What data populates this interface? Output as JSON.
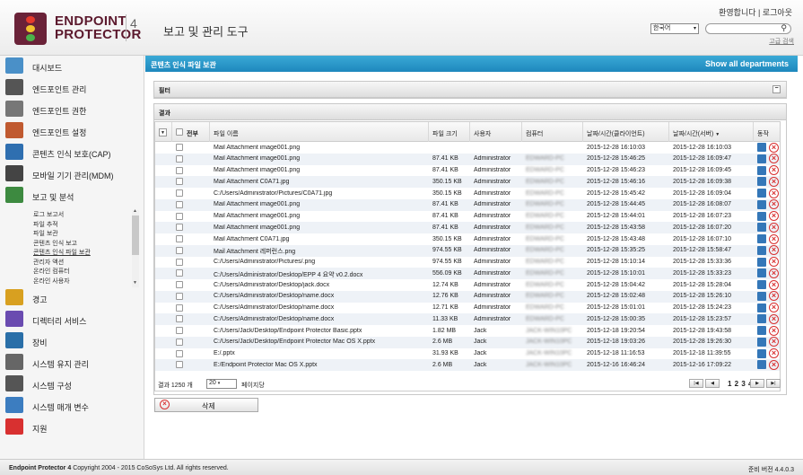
{
  "header": {
    "logo_line1": "ENDPOINT",
    "logo_line2": "PROTECTOR",
    "logo_version": "4",
    "app_title": "보고 및 관리 도구",
    "welcome": "환영합니다 | 로그아웃",
    "language": "한국어",
    "search_placeholder": "",
    "advanced_search": "고급 검색"
  },
  "sidebar": {
    "items": [
      {
        "label": "대시보드",
        "icon": "dashboard-icon",
        "color": "#4a90c8"
      },
      {
        "label": "엔드포인트 관리",
        "icon": "endpoint-management-icon",
        "color": "#555"
      },
      {
        "label": "엔드포인트 권한",
        "icon": "endpoint-rights-icon",
        "color": "#777"
      },
      {
        "label": "엔드포인트 설정",
        "icon": "endpoint-settings-icon",
        "color": "#c05a30"
      },
      {
        "label": "콘텐츠 인식 보호(CAP)",
        "icon": "content-aware-icon",
        "color": "#2f6fb0"
      },
      {
        "label": "모바일 기기 관리(MDM)",
        "icon": "mobile-device-icon",
        "color": "#444"
      },
      {
        "label": "보고 및 분석",
        "icon": "reports-icon",
        "color": "#3d8a40"
      },
      {
        "label": "경고",
        "icon": "alerts-icon",
        "color": "#d8a020"
      },
      {
        "label": "디렉터리 서비스",
        "icon": "directory-services-icon",
        "color": "#6a4bb0"
      },
      {
        "label": "장비",
        "icon": "appliance-icon",
        "color": "#2a6fa8"
      },
      {
        "label": "시스템 유지 관리",
        "icon": "system-maintenance-icon",
        "color": "#666"
      },
      {
        "label": "시스템 구성",
        "icon": "system-configuration-icon",
        "color": "#555"
      },
      {
        "label": "시스템 매개 변수",
        "icon": "system-parameters-icon",
        "color": "#3c7dc0"
      },
      {
        "label": "지원",
        "icon": "support-icon",
        "color": "#d83030"
      }
    ],
    "subitems": [
      "로그 보고서",
      "파일 추적",
      "파일 보관",
      "콘텐츠 인식 보고",
      "콘텐츠 인식 파일 보관",
      "관리자 액션",
      "온라인 컴퓨터",
      "온라인 사용자"
    ],
    "active_subitem": 4
  },
  "main": {
    "banner_title": "콘텐츠 인식 파일 보관",
    "banner_link": "Show all departments",
    "filter_label": "필터",
    "results_label": "결과",
    "collapse_symbol": "−",
    "columns": [
      "전부",
      "파일 이름",
      "파일 크기",
      "사용자",
      "컴퓨터",
      "날짜/시간(클라이언트)",
      "날짜/시간(서버)",
      "동작"
    ],
    "sort_indicator": "▼",
    "rows": [
      {
        "name": "Mail Attachment image001.png",
        "size": "",
        "user": "",
        "computer": "",
        "client": "2015-12-28 16:10:03",
        "server": "2015-12-28 16:10:03"
      },
      {
        "name": "Mail Attachment image001.png",
        "size": "87.41 KB",
        "user": "Administrator",
        "computer": "EDWARD-PC",
        "client": "2015-12-28 15:46:25",
        "server": "2015-12-28 16:09:47"
      },
      {
        "name": "Mail Attachment image001.png",
        "size": "87.41 KB",
        "user": "Administrator",
        "computer": "EDWARD-PC",
        "client": "2015-12-28 15:46:23",
        "server": "2015-12-28 16:09:45"
      },
      {
        "name": "Mail Attachment C0A71.jpg",
        "size": "350.15 KB",
        "user": "Administrator",
        "computer": "EDWARD-PC",
        "client": "2015-12-28 15:46:16",
        "server": "2015-12-28 16:09:38"
      },
      {
        "name": "C:/Users/Administrator/Pictures/C0A71.jpg",
        "size": "350.15 KB",
        "user": "Administrator",
        "computer": "EDWARD-PC",
        "client": "2015-12-28 15:45:42",
        "server": "2015-12-28 16:09:04"
      },
      {
        "name": "Mail Attachment image001.png",
        "size": "87.41 KB",
        "user": "Administrator",
        "computer": "EDWARD-PC",
        "client": "2015-12-28 15:44:45",
        "server": "2015-12-28 16:08:07"
      },
      {
        "name": "Mail Attachment image001.png",
        "size": "87.41 KB",
        "user": "Administrator",
        "computer": "EDWARD-PC",
        "client": "2015-12-28 15:44:01",
        "server": "2015-12-28 16:07:23"
      },
      {
        "name": "Mail Attachment image001.png",
        "size": "87.41 KB",
        "user": "Administrator",
        "computer": "EDWARD-PC",
        "client": "2015-12-28 15:43:58",
        "server": "2015-12-28 16:07:20"
      },
      {
        "name": "Mail Attachment C0A71.jpg",
        "size": "350.15 KB",
        "user": "Administrator",
        "computer": "EDWARD-PC",
        "client": "2015-12-28 15:43:48",
        "server": "2015-12-28 16:07:10"
      },
      {
        "name": "Mail Attachment 레퍼런스.png",
        "size": "974.55 KB",
        "user": "Administrator",
        "computer": "EDWARD-PC",
        "client": "2015-12-28 15:35:25",
        "server": "2015-12-28 15:58:47"
      },
      {
        "name": "C:/Users/Administrator/Pictures/.png",
        "size": "974.55 KB",
        "user": "Administrator",
        "computer": "EDWARD-PC",
        "client": "2015-12-28 15:10:14",
        "server": "2015-12-28 15:33:36"
      },
      {
        "name": "C:/Users/Administrator/Desktop/EPP 4 요약 v0.2.docx",
        "size": "556.09 KB",
        "user": "Administrator",
        "computer": "EDWARD-PC",
        "client": "2015-12-28 15:10:01",
        "server": "2015-12-28 15:33:23"
      },
      {
        "name": "C:/Users/Administrator/Desktop/jack.docx",
        "size": "12.74 KB",
        "user": "Administrator",
        "computer": "EDWARD-PC",
        "client": "2015-12-28 15:04:42",
        "server": "2015-12-28 15:28:04"
      },
      {
        "name": "C:/Users/Administrator/Desktop/name.docx",
        "size": "12.76 KB",
        "user": "Administrator",
        "computer": "EDWARD-PC",
        "client": "2015-12-28 15:02:48",
        "server": "2015-12-28 15:26:10"
      },
      {
        "name": "C:/Users/Administrator/Desktop/name.docx",
        "size": "12.71 KB",
        "user": "Administrator",
        "computer": "EDWARD-PC",
        "client": "2015-12-28 15:01:01",
        "server": "2015-12-28 15:24:23"
      },
      {
        "name": "C:/Users/Administrator/Desktop/name.docx",
        "size": "11.33 KB",
        "user": "Administrator",
        "computer": "EDWARD-PC",
        "client": "2015-12-28 15:00:35",
        "server": "2015-12-28 15:23:57"
      },
      {
        "name": "C:/Users/Jack/Desktop/Endpoint Protector Basic.pptx",
        "size": "1.82 MB",
        "user": "Jack",
        "computer": "JACK-WIN10PC",
        "client": "2015-12-18 19:20:54",
        "server": "2015-12-28 19:43:58"
      },
      {
        "name": "C:/Users/Jack/Desktop/Endpoint Protector Mac OS X.pptx",
        "size": "2.6 MB",
        "user": "Jack",
        "computer": "JACK-WIN10PC",
        "client": "2015-12-18 19:03:26",
        "server": "2015-12-28 19:26:30"
      },
      {
        "name": "E:/.pptx",
        "size": "31.93 KB",
        "user": "Jack",
        "computer": "JACK-WIN10PC",
        "client": "2015-12-18 11:16:53",
        "server": "2015-12-18 11:39:55"
      },
      {
        "name": "E:/Endpoint Protector Mac OS X.pptx",
        "size": "2.6 MB",
        "user": "Jack",
        "computer": "JACK-WIN10PC",
        "client": "2015-12-16 16:46:24",
        "server": "2015-12-16 17:09:22"
      }
    ],
    "pager": {
      "label_prefix": "결과 1250 개",
      "per_page": "20",
      "label_suffix": "페이지당",
      "first": "|◀",
      "prev": "◀",
      "pages": "1 2 3 4 5",
      "next": "▶",
      "last": "▶|"
    },
    "delete_label": "삭제"
  },
  "footer": {
    "brand": "Endpoint Protector 4",
    "copyright": "Copyright 2004 - 2015 CoSoSys Ltd. All rights reserved.",
    "version": "준비   버전 4.4.0.3"
  }
}
